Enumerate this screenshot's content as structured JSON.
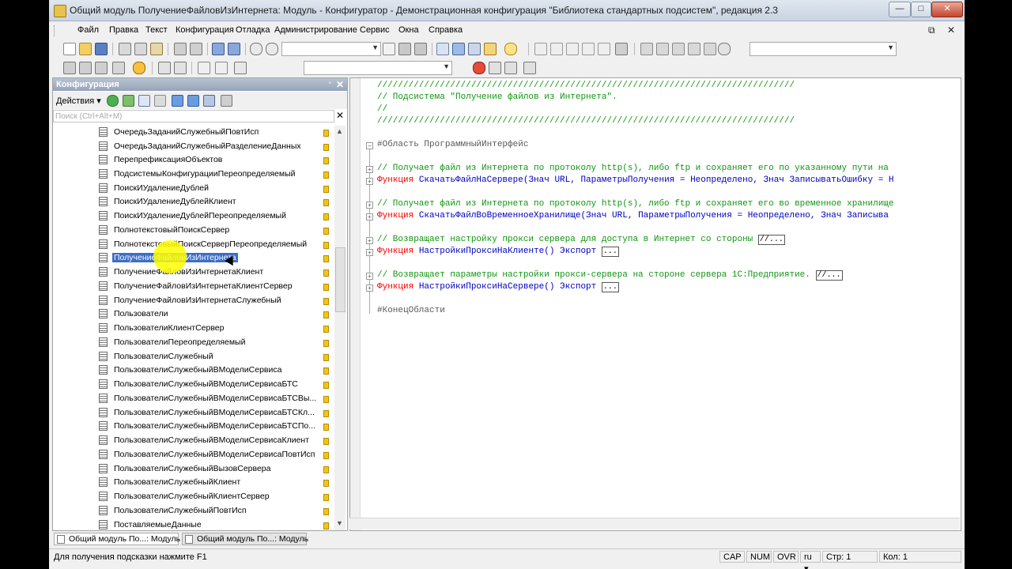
{
  "window": {
    "title": "Общий модуль ПолучениеФайловИзИнтернета: Модуль - Конфигуратор - Демонстрационная конфигурация \"Библиотека стандартных подсистем\", редакция 2.3",
    "minimize": "—",
    "maximize": "□",
    "close": "✕"
  },
  "menu": {
    "items": [
      "Файл",
      "Правка",
      "Текст",
      "Конфигурация",
      "Отладка",
      "Администрирование",
      "Сервис",
      "Окна",
      "Справка"
    ],
    "restore": "⧉",
    "close": "✕"
  },
  "panel": {
    "title": "Конфигурация",
    "pin": "▫",
    "close": "✕",
    "actions": "Действия ▾",
    "search_placeholder": "Поиск (Ctrl+Alt+M)",
    "search_clear": "✕",
    "items": [
      {
        "label": "ОчередьЗаданийСлужебныйПовтИсп",
        "selected": false
      },
      {
        "label": "ОчередьЗаданийСлужебныйРазделениеДанных",
        "selected": false
      },
      {
        "label": "ПерепрефиксацияОбъектов",
        "selected": false
      },
      {
        "label": "ПодсистемыКонфигурацииПереопределяемый",
        "selected": false
      },
      {
        "label": "ПоискИУдалениеДублей",
        "selected": false
      },
      {
        "label": "ПоискИУдалениеДублейКлиент",
        "selected": false
      },
      {
        "label": "ПоискИУдалениеДублейПереопределяемый",
        "selected": false
      },
      {
        "label": "ПолнотекстовыйПоискСервер",
        "selected": false
      },
      {
        "label": "ПолнотекстовыйПоискСерверПереопределяемый",
        "selected": false
      },
      {
        "label": "ПолучениеФайловИзИнтернета",
        "selected": true
      },
      {
        "label": "ПолучениеФайловИзИнтернетаКлиент",
        "selected": false
      },
      {
        "label": "ПолучениеФайловИзИнтернетаКлиентСервер",
        "selected": false
      },
      {
        "label": "ПолучениеФайловИзИнтернетаСлужебный",
        "selected": false
      },
      {
        "label": "Пользователи",
        "selected": false
      },
      {
        "label": "ПользователиКлиентСервер",
        "selected": false
      },
      {
        "label": "ПользователиПереопределяемый",
        "selected": false
      },
      {
        "label": "ПользователиСлужебный",
        "selected": false
      },
      {
        "label": "ПользователиСлужебныйВМоделиСервиса",
        "selected": false
      },
      {
        "label": "ПользователиСлужебныйВМоделиСервисаБТС",
        "selected": false
      },
      {
        "label": "ПользователиСлужебныйВМоделиСервисаБТСВы...",
        "selected": false
      },
      {
        "label": "ПользователиСлужебныйВМоделиСервисаБТСКл...",
        "selected": false
      },
      {
        "label": "ПользователиСлужебныйВМоделиСервисаБТСПо...",
        "selected": false
      },
      {
        "label": "ПользователиСлужебныйВМоделиСервисаКлиент",
        "selected": false
      },
      {
        "label": "ПользователиСлужебныйВМоделиСервисаПовтИсп",
        "selected": false
      },
      {
        "label": "ПользователиСлужебныйВызовСервера",
        "selected": false
      },
      {
        "label": "ПользователиСлужебныйКлиент",
        "selected": false
      },
      {
        "label": "ПользователиСлужебныйКлиентСервер",
        "selected": false
      },
      {
        "label": "ПользователиСлужебныйПовтИсп",
        "selected": false
      },
      {
        "label": "ПоставляемыеДанные",
        "selected": false
      }
    ]
  },
  "code": {
    "line1": "////////////////////////////////////////////////////////////////////////////////",
    "line2": "// Подсистема \"Получение файлов из Интернета\".",
    "line3": "//",
    "line4": "////////////////////////////////////////////////////////////////////////////////",
    "region_start": "#Область ПрограммныйИнтерфейс",
    "c1": "// Получает файл из Интернета по протоколу http(s), либо ftp и сохраняет его по указанному пути на",
    "f1_kw": "Функция",
    "f1_rest": " СкачатьФайлНаСервере(Знач URL, ПараметрыПолучения = Неопределено, Знач ЗаписыватьОшибку = Н",
    "c2": "// Получает файл из Интернета по протоколу http(s), либо ftp и сохраняет его во временное хранилище",
    "f2_kw": "Функция",
    "f2_rest": " СкачатьФайлВоВременноеХранилище(Знач URL, ПараметрыПолучения = Неопределено, Знач Записыва",
    "c3": "// Возвращает настройку прокси сервера для доступа в Интернет со стороны",
    "f3_kw": "Функция",
    "f3_rest": " НастройкиПроксиНаКлиенте() Экспорт",
    "c4": "// Возвращает параметры настройки прокси-сервера на стороне сервера 1С:Предприятие.",
    "f4_kw": "Функция",
    "f4_rest": " НастройкиПроксиНаСервере() Экспорт",
    "collapsed_comment": "//...",
    "collapsed_body": "...",
    "region_end": "#КонецОбласти"
  },
  "tabs": [
    {
      "label": "Общий модуль По...: Модуль"
    },
    {
      "label": "Общий модуль По...: Модуль"
    }
  ],
  "status": {
    "hint": "Для получения подсказки нажмите F1",
    "cap": "CAP",
    "num": "NUM",
    "ovr": "OVR",
    "lang": "ru ▾",
    "line": "Стр: 1",
    "col": "Кол: 1"
  }
}
